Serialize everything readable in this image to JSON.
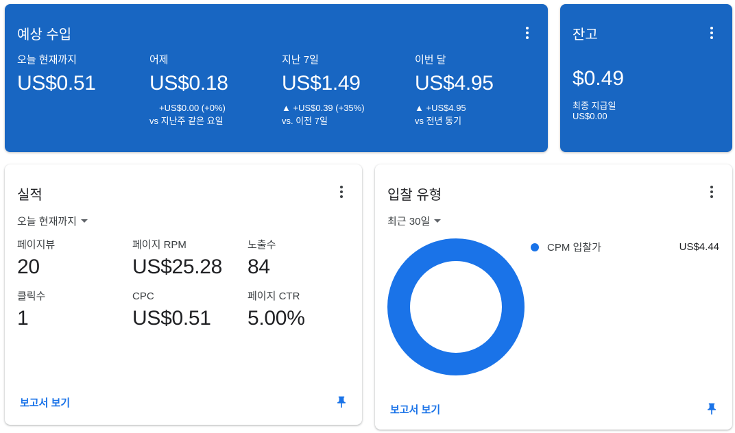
{
  "earnings": {
    "title": "예상 수입",
    "metrics": [
      {
        "label": "오늘 현재까지",
        "value": "US$0.51",
        "change": "",
        "compare": ""
      },
      {
        "label": "어제",
        "value": "US$0.18",
        "change": "+US$0.00 (+0%)",
        "compare": "vs 지난주 같은 요일"
      },
      {
        "label": "지난 7일",
        "value": "US$1.49",
        "change": "▲ +US$0.39 (+35%)",
        "compare": "vs. 이전 7일"
      },
      {
        "label": "이번 달",
        "value": "US$4.95",
        "change": "▲ +US$4.95",
        "compare": "vs 전년 동기"
      }
    ]
  },
  "balance": {
    "title": "잔고",
    "value": "$0.49",
    "last_payment_label": "최종 지급일",
    "last_payment_value": "US$0.00"
  },
  "performance": {
    "title": "실적",
    "period": "오늘 현재까지",
    "stats": [
      {
        "label": "페이지뷰",
        "value": "20"
      },
      {
        "label": "페이지 RPM",
        "value": "US$25.28"
      },
      {
        "label": "노출수",
        "value": "84"
      },
      {
        "label": "클릭수",
        "value": "1"
      },
      {
        "label": "CPC",
        "value": "US$0.51"
      },
      {
        "label": "페이지 CTR",
        "value": "5.00%"
      }
    ],
    "report_link": "보고서 보기"
  },
  "bid_type": {
    "title": "입찰 유형",
    "period": "최근 30일",
    "report_link": "보고서 보기"
  },
  "chart_data": {
    "type": "pie",
    "title": "",
    "categories": [
      "CPM 입찰가"
    ],
    "values": [
      4.44
    ],
    "value_labels": [
      "US$4.44"
    ],
    "donut": true,
    "colors": [
      "#1a73e8"
    ],
    "legend_position": "right"
  },
  "colors": {
    "header_blue": "#1866c2",
    "accent": "#1a73e8"
  },
  "icons": {
    "menu": "more-vert-icon",
    "dropdown": "arrow-drop-down-icon",
    "pin": "push-pin-icon"
  }
}
